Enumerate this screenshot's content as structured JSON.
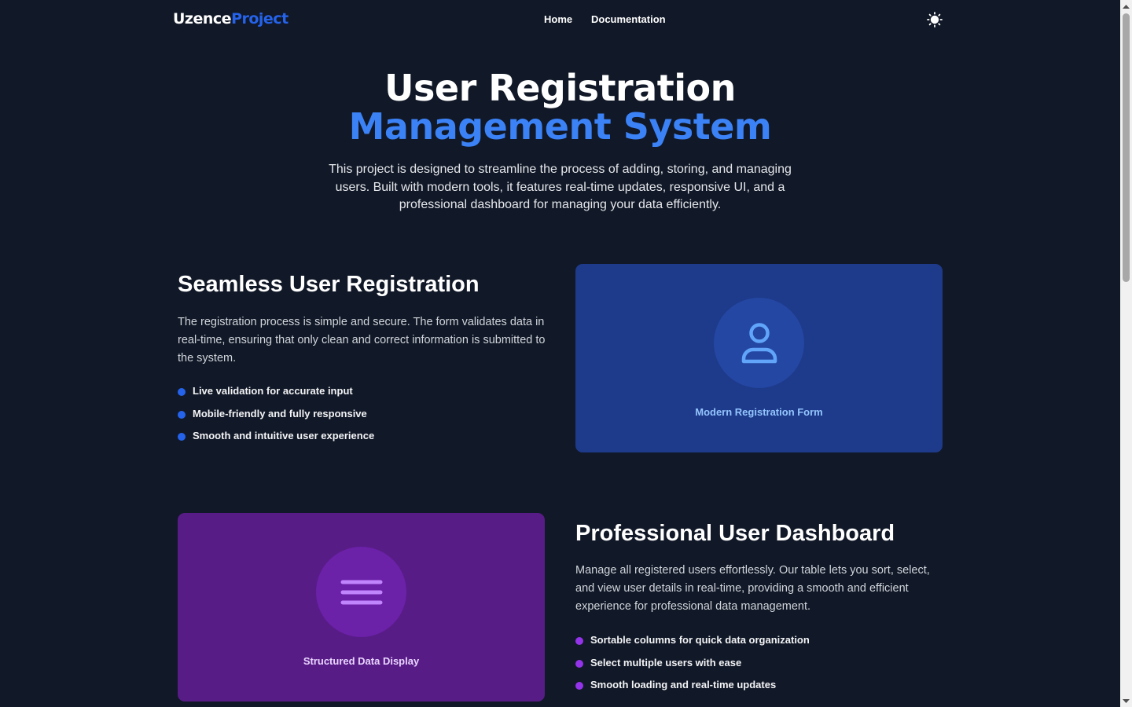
{
  "brand": {
    "part1": "Uzence",
    "part2": "Project"
  },
  "nav": {
    "home": "Home",
    "documentation": "Documentation"
  },
  "hero": {
    "title_line1": "User Registration",
    "title_line2": "Management System",
    "description": "This project is designed to streamline the process of adding, storing, and managing users. Built with modern tools, it features real-time updates, responsive UI, and a professional dashboard for managing your data efficiently."
  },
  "registration": {
    "title": "Seamless User Registration",
    "description": "The registration process is simple and secure. The form validates data in real-time, ensuring that only clean and correct information is submitted to the system.",
    "bullets": [
      "Live validation for accurate input",
      "Mobile-friendly and fully responsive",
      "Smooth and intuitive user experience"
    ],
    "card_caption": "Modern Registration Form",
    "card_icon": "user-icon"
  },
  "dashboard": {
    "title": "Professional User Dashboard",
    "description": "Manage all registered users effortlessly. Our table lets you sort, select, and view user details in real-time, providing a smooth and efficient experience for professional data management.",
    "bullets": [
      "Sortable columns for quick data organization",
      "Select multiple users with ease",
      "Smooth loading and real-time updates"
    ],
    "card_caption": "Structured Data Display",
    "card_icon": "menu-lines-icon"
  },
  "colors": {
    "background": "#111827",
    "accent_blue": "#3b82f6",
    "brand_blue": "#2563eb",
    "card_blue": "#1e3a8a",
    "card_purple": "#581c87",
    "bullet_blue": "#2563eb",
    "bullet_purple": "#9333ea"
  }
}
